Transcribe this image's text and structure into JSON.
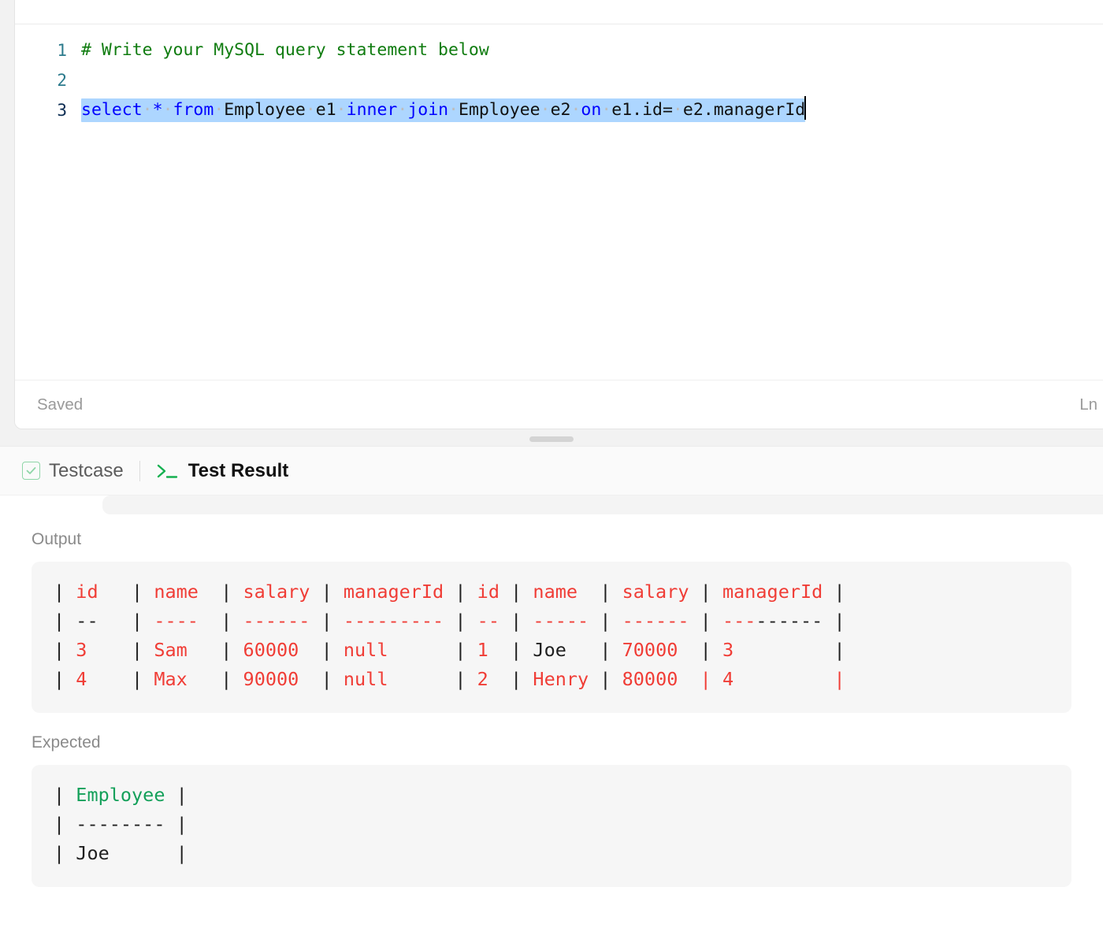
{
  "editor": {
    "status_left": "Saved",
    "status_right": "Ln",
    "lines": [
      {
        "number": "1",
        "active": false,
        "text": "# Write your MySQL query statement below"
      },
      {
        "number": "2",
        "active": false,
        "text": ""
      },
      {
        "number": "3",
        "active": true,
        "text": "select * from Employee e1 inner join Employee e2 on e1.id= e2.managerId"
      }
    ],
    "tokens_line3": {
      "kw_select": "select",
      "op_star": "*",
      "kw_from": "from",
      "tbl1": "Employee",
      "alias1": "e1",
      "kw_inner": "inner",
      "kw_join": "join",
      "tbl2": "Employee",
      "alias2": "e2",
      "kw_on": "on",
      "cond_left": "e1.id=",
      "cond_right": "e2.managerId"
    },
    "comment_line1": "# Write your MySQL query statement below",
    "colors": {
      "comment": "#107c10",
      "keyword": "#0000ff",
      "plain": "#111111",
      "selection": "#add6ff",
      "gutter": "#2b7a8c",
      "gutter_active": "#0b2c52"
    }
  },
  "result": {
    "tabs": [
      {
        "id": "testcase",
        "label": "Testcase",
        "icon": "checkbox-check-icon",
        "active": false
      },
      {
        "id": "testresult",
        "label": "Test Result",
        "icon": "terminal-prompt-icon",
        "active": true
      }
    ],
    "output": {
      "label": "Output",
      "rows": [
        {
          "cells": [
            {
              "t": "| ",
              "c": "dark"
            },
            {
              "t": "id",
              "c": "red"
            },
            {
              "t": "   ",
              "c": "red"
            },
            {
              "t": "| ",
              "c": "dark"
            },
            {
              "t": "name",
              "c": "red"
            },
            {
              "t": "  ",
              "c": "red"
            },
            {
              "t": "| ",
              "c": "dark"
            },
            {
              "t": "salary",
              "c": "red"
            },
            {
              "t": " ",
              "c": "red"
            },
            {
              "t": "| ",
              "c": "dark"
            },
            {
              "t": "managerId",
              "c": "red"
            },
            {
              "t": " ",
              "c": "red"
            },
            {
              "t": "| ",
              "c": "dark"
            },
            {
              "t": "id",
              "c": "red"
            },
            {
              "t": " ",
              "c": "red"
            },
            {
              "t": "| ",
              "c": "dark"
            },
            {
              "t": "name",
              "c": "red"
            },
            {
              "t": "  ",
              "c": "red"
            },
            {
              "t": "| ",
              "c": "dark"
            },
            {
              "t": "salary",
              "c": "red"
            },
            {
              "t": " ",
              "c": "red"
            },
            {
              "t": "| ",
              "c": "dark"
            },
            {
              "t": "managerId",
              "c": "red"
            },
            {
              "t": " ",
              "c": "red"
            },
            {
              "t": "|",
              "c": "dark"
            }
          ]
        },
        {
          "cells": [
            {
              "t": "| ",
              "c": "dark"
            },
            {
              "t": "--",
              "c": "dark"
            },
            {
              "t": "   ",
              "c": "red"
            },
            {
              "t": "| ",
              "c": "dark"
            },
            {
              "t": "----",
              "c": "red"
            },
            {
              "t": "  ",
              "c": "red"
            },
            {
              "t": "| ",
              "c": "dark"
            },
            {
              "t": "------",
              "c": "red"
            },
            {
              "t": " ",
              "c": "red"
            },
            {
              "t": "| ",
              "c": "dark"
            },
            {
              "t": "---------",
              "c": "red"
            },
            {
              "t": " ",
              "c": "red"
            },
            {
              "t": "| ",
              "c": "dark"
            },
            {
              "t": "--",
              "c": "red"
            },
            {
              "t": " ",
              "c": "red"
            },
            {
              "t": "| ",
              "c": "dark"
            },
            {
              "t": "-----",
              "c": "red"
            },
            {
              "t": " ",
              "c": "red"
            },
            {
              "t": "| ",
              "c": "dark"
            },
            {
              "t": "------",
              "c": "red"
            },
            {
              "t": " ",
              "c": "red"
            },
            {
              "t": "| ",
              "c": "dark"
            },
            {
              "t": "---",
              "c": "red"
            },
            {
              "t": "------",
              "c": "dark"
            },
            {
              "t": " ",
              "c": "red"
            },
            {
              "t": "|",
              "c": "dark"
            }
          ]
        },
        {
          "cells": [
            {
              "t": "| ",
              "c": "dark"
            },
            {
              "t": "3",
              "c": "red"
            },
            {
              "t": "    ",
              "c": "red"
            },
            {
              "t": "| ",
              "c": "dark"
            },
            {
              "t": "Sam",
              "c": "red"
            },
            {
              "t": "   ",
              "c": "red"
            },
            {
              "t": "| ",
              "c": "dark"
            },
            {
              "t": "60000",
              "c": "red"
            },
            {
              "t": "  ",
              "c": "red"
            },
            {
              "t": "| ",
              "c": "dark"
            },
            {
              "t": "null",
              "c": "red"
            },
            {
              "t": "      ",
              "c": "red"
            },
            {
              "t": "| ",
              "c": "dark"
            },
            {
              "t": "1",
              "c": "red"
            },
            {
              "t": "  ",
              "c": "red"
            },
            {
              "t": "| ",
              "c": "dark"
            },
            {
              "t": "Joe",
              "c": "dark"
            },
            {
              "t": "   ",
              "c": "red"
            },
            {
              "t": "| ",
              "c": "dark"
            },
            {
              "t": "70000",
              "c": "red"
            },
            {
              "t": "  ",
              "c": "red"
            },
            {
              "t": "| ",
              "c": "dark"
            },
            {
              "t": "3",
              "c": "red"
            },
            {
              "t": "         ",
              "c": "red"
            },
            {
              "t": "|",
              "c": "dark"
            }
          ]
        },
        {
          "cells": [
            {
              "t": "| ",
              "c": "dark"
            },
            {
              "t": "4",
              "c": "red"
            },
            {
              "t": "    ",
              "c": "red"
            },
            {
              "t": "| ",
              "c": "dark"
            },
            {
              "t": "Max",
              "c": "red"
            },
            {
              "t": "   ",
              "c": "red"
            },
            {
              "t": "| ",
              "c": "dark"
            },
            {
              "t": "90000",
              "c": "red"
            },
            {
              "t": "  ",
              "c": "red"
            },
            {
              "t": "| ",
              "c": "dark"
            },
            {
              "t": "null",
              "c": "red"
            },
            {
              "t": "      ",
              "c": "red"
            },
            {
              "t": "| ",
              "c": "dark"
            },
            {
              "t": "2",
              "c": "red"
            },
            {
              "t": "  ",
              "c": "red"
            },
            {
              "t": "| ",
              "c": "dark"
            },
            {
              "t": "Henry",
              "c": "red"
            },
            {
              "t": " ",
              "c": "red"
            },
            {
              "t": "| ",
              "c": "dark"
            },
            {
              "t": "80000",
              "c": "red"
            },
            {
              "t": "  ",
              "c": "red"
            },
            {
              "t": "| ",
              "c": "red"
            },
            {
              "t": "4",
              "c": "red"
            },
            {
              "t": "         ",
              "c": "red"
            },
            {
              "t": "|",
              "c": "red"
            }
          ]
        }
      ],
      "table": {
        "headers": [
          "id",
          "name",
          "salary",
          "managerId",
          "id",
          "name",
          "salary",
          "managerId"
        ],
        "data_rows": [
          [
            "3",
            "Sam",
            "60000",
            "null",
            "1",
            "Joe",
            "70000",
            "3"
          ],
          [
            "4",
            "Max",
            "90000",
            "null",
            "2",
            "Henry",
            "80000",
            "4"
          ]
        ]
      }
    },
    "expected": {
      "label": "Expected",
      "rows": [
        {
          "cells": [
            {
              "t": "| ",
              "c": "dark"
            },
            {
              "t": "Employee",
              "c": "green"
            },
            {
              "t": " ",
              "c": "dark"
            },
            {
              "t": "|",
              "c": "dark"
            }
          ]
        },
        {
          "cells": [
            {
              "t": "| ",
              "c": "dark"
            },
            {
              "t": "--------",
              "c": "dark"
            },
            {
              "t": " ",
              "c": "dark"
            },
            {
              "t": "|",
              "c": "dark"
            }
          ]
        },
        {
          "cells": [
            {
              "t": "| ",
              "c": "dark"
            },
            {
              "t": "Joe",
              "c": "dark"
            },
            {
              "t": "      ",
              "c": "dark"
            },
            {
              "t": "|",
              "c": "dark"
            }
          ]
        }
      ],
      "table": {
        "headers": [
          "Employee"
        ],
        "data_rows": [
          [
            "Joe"
          ]
        ]
      }
    }
  },
  "colors": {
    "red": "#f03d36",
    "green": "#14a05a",
    "dark": "#1f1f1f",
    "panel_bg": "#f6f6f6",
    "accent_green": "#14b050"
  }
}
